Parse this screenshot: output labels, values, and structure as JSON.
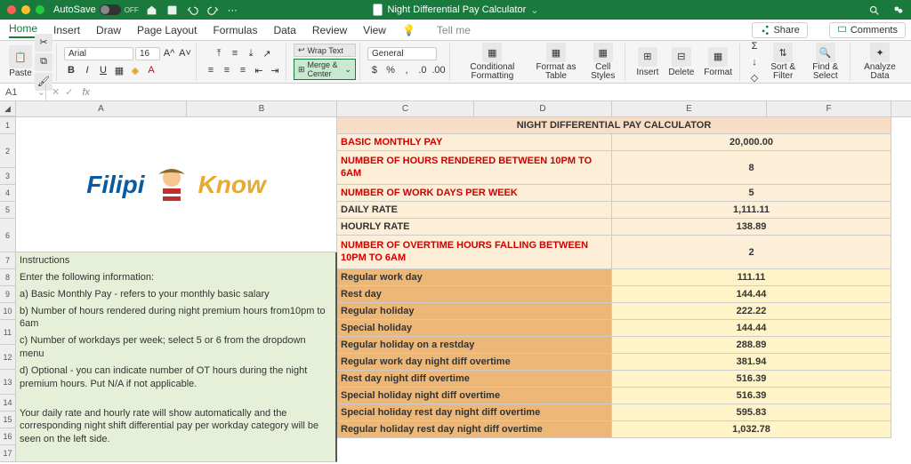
{
  "titlebar": {
    "autosave": "AutoSave",
    "off": "OFF",
    "doc": "Night Differential Pay Calculator"
  },
  "menu": {
    "items": [
      "Home",
      "Insert",
      "Draw",
      "Page Layout",
      "Formulas",
      "Data",
      "Review",
      "View"
    ],
    "tellme": "Tell me",
    "share": "Share",
    "comments": "Comments"
  },
  "ribbon": {
    "paste": "Paste",
    "font": "Arial",
    "size": "16",
    "wrap": "Wrap Text",
    "merge": "Merge & Center",
    "numfmt": "General",
    "cond": "Conditional Formatting",
    "fmt_table": "Format as Table",
    "cell_styles": "Cell Styles",
    "insert": "Insert",
    "delete": "Delete",
    "format": "Format",
    "sort": "Sort & Filter",
    "find": "Find & Select",
    "analyze": "Analyze Data"
  },
  "namebox": {
    "cell": "A1",
    "fx": "fx"
  },
  "cols": [
    "A",
    "B",
    "C",
    "D",
    "E",
    "F"
  ],
  "sheet": {
    "title": "NIGHT DIFFERENTIAL PAY CALCULATOR",
    "rows": [
      {
        "label": "BASIC MONTHLY PAY",
        "value": "20,000.00",
        "red": true,
        "key": true
      },
      {
        "label": "NUMBER OF HOURS RENDERED BETWEEN 10PM TO 6AM",
        "value": "8",
        "red": true,
        "key": true,
        "tall": true
      },
      {
        "label": "NUMBER OF WORK DAYS PER WEEK",
        "value": "5",
        "red": true,
        "key": true
      },
      {
        "label": "DAILY RATE",
        "value": "1,111.11",
        "red": false,
        "key": true
      },
      {
        "label": "HOURLY RATE",
        "value": "138.89",
        "red": false,
        "key": true
      },
      {
        "label": "NUMBER OF OVERTIME HOURS FALLING BETWEEN 10PM TO 6AM",
        "value": "2",
        "red": true,
        "key": true,
        "tall": true
      },
      {
        "label": "Regular work day",
        "value": "111.11",
        "cat": true
      },
      {
        "label": "Rest day",
        "value": "144.44",
        "cat": true
      },
      {
        "label": "Regular holiday",
        "value": "222.22",
        "cat": true
      },
      {
        "label": "Special holiday",
        "value": "144.44",
        "cat": true
      },
      {
        "label": "Regular holiday on a restday",
        "value": "288.89",
        "cat": true
      },
      {
        "label": "Regular work day night diff overtime",
        "value": "381.94",
        "cat": true
      },
      {
        "label": "Rest day night diff overtime",
        "value": "516.39",
        "cat": true
      },
      {
        "label": "Special holiday night diff overtime",
        "value": "516.39",
        "cat": true
      },
      {
        "label": "Special holiday rest day night  diff overtime",
        "value": "595.83",
        "cat": true
      },
      {
        "label": "Regular holiday rest day night diff overtime",
        "value": "1,032.78",
        "cat": true
      }
    ]
  },
  "instructions": {
    "h": "Instructions",
    "l0": "Enter the following information:",
    "l1": "a) Basic Monthly Pay - refers to your monthly basic salary",
    "l2": "b) Number of hours rendered during night premium hours from10pm to 6am",
    "l3": "c) Number of workdays per week; select 5 or 6 from the dropdown menu",
    "l4": "d) Optional - you can indicate number of OT hours during the night premium hours. Put N/A if not applicable.",
    "l5": "Your daily rate and hourly rate will show automatically and the corresponding night shift differential pay per workday category will be seen on the left side."
  },
  "logo": {
    "p1": "Filipi",
    "p2": "Know"
  }
}
